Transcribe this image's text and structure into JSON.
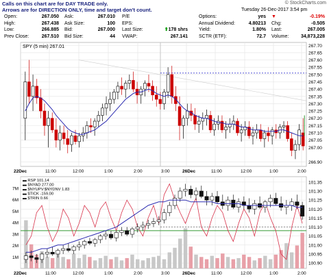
{
  "notice": [
    "Calls on this chart are for DAY TRADE only.",
    "Arrows are for DIRECTION ONLY, time and target don't count."
  ],
  "brand": "© StockCharts.com",
  "datetime": "Tuesday 26-Dec-2017   3:54 pm",
  "quote": {
    "col1": [
      [
        "Open:",
        "267.050"
      ],
      [
        "High:",
        "267.438"
      ],
      [
        "Low:",
        "266.885"
      ],
      [
        "Prev Close:",
        "267.510"
      ]
    ],
    "col2": [
      [
        "Ask:",
        "267.010"
      ],
      [
        "Ask Size:",
        "100"
      ],
      [
        "Bid:",
        "267.000"
      ],
      [
        "Bid Size:",
        "44"
      ]
    ],
    "col3": [
      [
        "P/E",
        ""
      ],
      [
        "EPS:",
        ""
      ],
      [
        "Last Size:",
        "178 shrs"
      ],
      [
        "VWAP:",
        "267.141"
      ]
    ],
    "col4": [
      [
        "Options:",
        "yes"
      ],
      [
        "Annual Dividend:",
        "4.80213"
      ],
      [
        "Yield:",
        "1.80%"
      ],
      [
        "SCTR (ETF):",
        "72.7"
      ]
    ],
    "col5": [
      [
        "",
        "-0.19%"
      ],
      [
        "Chg:",
        "-0.505"
      ],
      [
        "Last:",
        "267.005"
      ],
      [
        "Volume:",
        "34,873,228"
      ]
    ]
  },
  "colors": {
    "up": "#000000",
    "down": "#cc0000",
    "ma": "#2b2bb0",
    "upper_line": "#1d1dcc",
    "rsp": "#111111",
    "nyad": "#d8324a",
    "vol": "#c8c8c8",
    "vol_red": "#e8a0a8",
    "green": "#339933"
  },
  "chart_data": [
    {
      "type": "candlestick",
      "title": "SPY (5 min) 267.01",
      "x_labels": [
        "22Dec",
        "11:00",
        "12:00",
        "1:00",
        "2:00",
        "3:00",
        "26Dec",
        "11:00",
        "12:00",
        "1:00",
        "2:00",
        "3:00"
      ],
      "y_ticks": [
        266.9,
        267.0,
        267.05,
        267.1,
        267.15,
        267.2,
        267.25,
        267.3,
        267.35,
        267.4,
        267.45,
        267.5,
        267.55,
        267.6,
        267.65,
        267.7
      ],
      "ylim": [
        266.87,
        267.72
      ],
      "dashed_level": 267.51,
      "candles_ohlc": [
        [
          267.2,
          267.52,
          267.05,
          267.45
        ],
        [
          267.45,
          267.6,
          267.3,
          267.35
        ],
        [
          267.35,
          267.5,
          267.25,
          267.42
        ],
        [
          267.42,
          267.47,
          267.3,
          267.34
        ],
        [
          267.34,
          267.4,
          267.2,
          267.25
        ],
        [
          267.25,
          267.3,
          267.08,
          267.15
        ],
        [
          267.15,
          267.25,
          267.0,
          267.2
        ],
        [
          267.2,
          267.24,
          267.1,
          267.12
        ],
        [
          267.12,
          267.2,
          267.0,
          267.05
        ],
        [
          267.05,
          267.15,
          266.98,
          267.1
        ],
        [
          267.1,
          267.15,
          267.02,
          267.06
        ],
        [
          267.06,
          267.12,
          266.96,
          267.02
        ],
        [
          267.02,
          267.1,
          266.97,
          267.08
        ],
        [
          267.08,
          267.12,
          267.02,
          267.04
        ],
        [
          267.04,
          267.1,
          267.0,
          267.08
        ],
        [
          267.08,
          267.14,
          267.04,
          267.1
        ],
        [
          267.1,
          267.18,
          267.06,
          267.15
        ],
        [
          267.15,
          267.2,
          267.1,
          267.14
        ],
        [
          267.14,
          267.2,
          267.08,
          267.18
        ],
        [
          267.18,
          267.25,
          267.14,
          267.22
        ],
        [
          267.22,
          267.3,
          267.18,
          267.27
        ],
        [
          267.27,
          267.35,
          267.22,
          267.3
        ],
        [
          267.3,
          267.38,
          267.25,
          267.33
        ],
        [
          267.33,
          267.4,
          267.3,
          267.38
        ],
        [
          267.38,
          267.45,
          267.33,
          267.42
        ],
        [
          267.42,
          267.48,
          267.36,
          267.4
        ],
        [
          267.4,
          267.46,
          267.34,
          267.44
        ],
        [
          267.44,
          267.5,
          267.4,
          267.46
        ],
        [
          267.46,
          267.52,
          267.38,
          267.4
        ],
        [
          267.4,
          267.45,
          267.3,
          267.36
        ],
        [
          267.36,
          267.42,
          267.3,
          267.4
        ],
        [
          267.4,
          267.46,
          267.35,
          267.44
        ],
        [
          267.44,
          267.5,
          267.38,
          267.42
        ],
        [
          267.42,
          267.46,
          267.32,
          267.36
        ],
        [
          267.36,
          267.42,
          267.28,
          267.33
        ],
        [
          267.33,
          267.38,
          267.26,
          267.3
        ],
        [
          267.3,
          267.4,
          267.26,
          267.38
        ],
        [
          267.38,
          267.55,
          267.34,
          267.5
        ],
        [
          267.5,
          267.56,
          267.3,
          267.35
        ],
        [
          267.35,
          267.42,
          267.25,
          267.3
        ],
        [
          267.28,
          267.35,
          267.05,
          267.15
        ],
        [
          267.15,
          267.22,
          267.06,
          267.2
        ],
        [
          267.2,
          267.3,
          267.15,
          267.25
        ],
        [
          267.25,
          267.3,
          267.18,
          267.22
        ],
        [
          267.22,
          267.27,
          267.12,
          267.16
        ],
        [
          267.16,
          267.22,
          267.1,
          267.18
        ],
        [
          267.18,
          267.24,
          267.12,
          267.2
        ],
        [
          267.2,
          267.26,
          267.15,
          267.22
        ],
        [
          267.22,
          267.25,
          267.1,
          267.12
        ],
        [
          267.12,
          267.2,
          267.08,
          267.16
        ],
        [
          267.16,
          267.22,
          267.12,
          267.18
        ],
        [
          267.18,
          267.22,
          267.1,
          267.12
        ],
        [
          267.12,
          267.18,
          267.06,
          267.14
        ],
        [
          267.14,
          267.2,
          267.1,
          267.16
        ],
        [
          267.16,
          267.22,
          267.12,
          267.18
        ],
        [
          267.18,
          267.2,
          267.08,
          267.1
        ],
        [
          267.1,
          267.16,
          267.04,
          267.12
        ],
        [
          267.12,
          267.18,
          267.08,
          267.14
        ],
        [
          267.14,
          267.18,
          267.06,
          267.08
        ],
        [
          267.08,
          267.14,
          267.02,
          267.1
        ],
        [
          267.1,
          267.16,
          267.06,
          267.12
        ],
        [
          267.12,
          267.16,
          267.04,
          267.06
        ],
        [
          267.06,
          267.12,
          267.0,
          267.1
        ],
        [
          267.1,
          267.14,
          267.04,
          267.08
        ],
        [
          267.08,
          267.14,
          267.02,
          267.12
        ],
        [
          267.12,
          267.16,
          267.06,
          267.1
        ],
        [
          267.1,
          267.16,
          267.06,
          267.14
        ],
        [
          267.14,
          267.18,
          267.1,
          267.15
        ],
        [
          267.15,
          267.18,
          267.04,
          267.06
        ],
        [
          267.06,
          267.1,
          266.94,
          266.98
        ],
        [
          266.98,
          267.05,
          266.92,
          267.02
        ],
        [
          267.02,
          267.16,
          266.98,
          267.12
        ],
        [
          267.1,
          267.2,
          266.98,
          267.01
        ]
      ],
      "ma_values": [
        267.25,
        267.3,
        267.34,
        267.35,
        267.34,
        267.32,
        267.29,
        267.26,
        267.22,
        267.19,
        267.16,
        267.13,
        267.11,
        267.1,
        267.09,
        267.09,
        267.1,
        267.11,
        267.12,
        267.14,
        267.16,
        267.18,
        267.21,
        267.24,
        267.27,
        267.3,
        267.33,
        267.35,
        267.37,
        267.38,
        267.38,
        267.39,
        267.4,
        267.39,
        267.37,
        267.36,
        267.35,
        267.36,
        267.35,
        267.33,
        267.3,
        267.27,
        267.25,
        267.24,
        267.22,
        267.21,
        267.2,
        267.2,
        267.19,
        267.18,
        267.17,
        267.17,
        267.16,
        267.16,
        267.16,
        267.15,
        267.14,
        267.14,
        267.13,
        267.12,
        267.12,
        267.12,
        267.11,
        267.11,
        267.11,
        267.11,
        267.12,
        267.12,
        267.11,
        267.1,
        267.09,
        267.08,
        267.08
      ]
    },
    {
      "type": "line",
      "series_labels": [
        "RSP 101.14",
        "$NYAD 277.00",
        "$NYUPV:$NYDNV 1.83",
        "$TICK -159.00",
        "$TRIN 0.66"
      ],
      "x_labels": [
        "22Dec",
        "11:00",
        "12:00",
        "1:00",
        "2:00",
        "3:00",
        "26Dec",
        "11:00",
        "12:00",
        "1:00",
        "2:00",
        "3:00"
      ],
      "y_right_ticks": [
        "101.35",
        "101.30",
        "101.25",
        "101.20",
        "101.15",
        "101.10",
        "101.05",
        "101.00",
        "100.95",
        "100.90"
      ],
      "ylim_right": [
        100.87,
        101.38
      ],
      "y_left_ticks": [
        "7M",
        "6M",
        "5M",
        "4M",
        "3M",
        "2M",
        "1M"
      ],
      "rsp_ohlc": [
        [
          100.92,
          100.96,
          100.9,
          100.94
        ],
        [
          100.94,
          100.97,
          100.91,
          100.93
        ],
        [
          100.93,
          100.95,
          100.9,
          100.92
        ],
        [
          100.92,
          100.96,
          100.9,
          100.95
        ],
        [
          100.95,
          100.98,
          100.93,
          100.96
        ],
        [
          100.96,
          100.99,
          100.94,
          100.95
        ],
        [
          100.95,
          100.98,
          100.93,
          100.97
        ],
        [
          100.97,
          101.0,
          100.95,
          100.98
        ],
        [
          100.98,
          101.01,
          100.96,
          100.97
        ],
        [
          100.97,
          101.0,
          100.95,
          100.99
        ],
        [
          100.99,
          101.02,
          100.97,
          101.0
        ],
        [
          101.0,
          101.03,
          100.98,
          101.02
        ],
        [
          101.02,
          101.04,
          101.0,
          101.01
        ],
        [
          101.01,
          101.04,
          100.99,
          101.03
        ],
        [
          101.03,
          101.06,
          101.01,
          101.05
        ],
        [
          101.05,
          101.08,
          101.03,
          101.06
        ],
        [
          101.06,
          101.08,
          101.03,
          101.04
        ],
        [
          101.04,
          101.08,
          101.02,
          101.07
        ],
        [
          101.07,
          101.1,
          101.05,
          101.08
        ],
        [
          101.08,
          101.1,
          101.05,
          101.06
        ],
        [
          101.06,
          101.1,
          101.04,
          101.09
        ],
        [
          101.09,
          101.12,
          101.07,
          101.1
        ],
        [
          101.1,
          101.13,
          101.08,
          101.11
        ],
        [
          101.11,
          101.14,
          101.09,
          101.12
        ],
        [
          101.12,
          101.15,
          101.1,
          101.13
        ],
        [
          101.13,
          101.16,
          101.11,
          101.14
        ],
        [
          101.14,
          101.2,
          101.12,
          101.18
        ],
        [
          101.18,
          101.24,
          101.16,
          101.22
        ],
        [
          101.22,
          101.28,
          101.2,
          101.26
        ],
        [
          101.26,
          101.32,
          101.24,
          101.3
        ],
        [
          101.3,
          101.34,
          101.27,
          101.31
        ],
        [
          101.31,
          101.33,
          101.26,
          101.28
        ],
        [
          101.28,
          101.32,
          101.25,
          101.3
        ],
        [
          101.3,
          101.33,
          101.26,
          101.27
        ],
        [
          101.27,
          101.3,
          101.22,
          101.25
        ],
        [
          101.25,
          101.29,
          101.22,
          101.27
        ],
        [
          101.27,
          101.3,
          101.23,
          101.24
        ],
        [
          101.24,
          101.28,
          101.2,
          101.22
        ],
        [
          101.22,
          101.27,
          101.19,
          101.25
        ],
        [
          101.25,
          101.28,
          101.2,
          101.21
        ],
        [
          101.21,
          101.26,
          101.18,
          101.24
        ],
        [
          101.24,
          101.27,
          101.2,
          101.22
        ],
        [
          101.22,
          101.26,
          101.18,
          101.2
        ],
        [
          101.2,
          101.25,
          101.17,
          101.23
        ],
        [
          101.23,
          101.27,
          101.2,
          101.21
        ],
        [
          101.21,
          101.25,
          101.18,
          101.24
        ],
        [
          101.24,
          101.28,
          101.21,
          101.26
        ],
        [
          101.26,
          101.29,
          101.22,
          101.23
        ],
        [
          101.23,
          101.27,
          101.19,
          101.21
        ],
        [
          101.21,
          101.25,
          101.17,
          101.22
        ],
        [
          101.22,
          101.26,
          101.19,
          101.24
        ],
        [
          101.24,
          101.28,
          101.2,
          101.22
        ],
        [
          101.22,
          101.24,
          101.14,
          101.16
        ]
      ],
      "nyad_values": [
        101.0,
        101.05,
        101.18,
        101.22,
        101.1,
        101.02,
        101.08,
        101.2,
        101.15,
        101.05,
        101.12,
        101.22,
        101.18,
        101.1,
        101.2,
        101.24,
        101.15,
        101.08,
        101.18,
        101.25,
        101.2,
        101.1,
        101.05,
        101.15,
        101.22,
        101.12,
        101.28,
        101.34,
        101.25,
        101.18,
        101.12,
        101.2,
        101.26,
        101.1,
        101.05,
        101.15,
        101.22,
        101.18,
        101.08,
        101.02,
        101.12,
        101.2,
        101.15,
        101.05,
        101.18,
        101.24,
        101.15,
        101.08,
        100.95,
        100.92,
        101.1,
        101.22,
        101.12
      ],
      "ma_values": [
        100.96,
        100.96,
        100.97,
        100.98,
        100.98,
        100.99,
        101.0,
        101.0,
        101.01,
        101.02,
        101.03,
        101.04,
        101.05,
        101.06,
        101.07,
        101.08,
        101.09,
        101.1,
        101.12,
        101.14,
        101.16,
        101.18,
        101.2,
        101.22,
        101.23,
        101.24,
        101.24,
        101.25,
        101.25,
        101.25,
        101.25,
        101.24,
        101.24,
        101.24,
        101.24,
        101.24,
        101.23,
        101.23,
        101.23,
        101.23,
        101.23,
        101.22,
        101.22,
        101.22,
        101.22,
        101.22,
        101.22,
        101.22,
        101.22,
        101.22,
        101.22,
        101.21,
        101.21
      ],
      "green_level": 101.08,
      "dashed_level": 101.1,
      "volume_m": [
        4.2,
        2.1,
        1.2,
        1.5,
        1.0,
        0.9,
        1.4,
        1.0,
        0.8,
        1.3,
        0.9,
        1.2,
        1.0,
        0.7,
        0.9,
        1.1,
        0.8,
        1.0,
        0.7,
        0.9,
        1.2,
        0.8,
        0.7,
        0.9,
        1.0,
        1.1,
        0.8,
        1.4,
        1.8,
        2.6,
        3.5,
        1.9,
        1.2,
        1.0,
        0.8,
        1.1,
        0.9,
        1.3,
        1.0,
        0.8,
        0.9,
        1.2,
        1.0,
        0.7,
        0.9,
        1.1,
        0.8,
        1.2,
        1.6,
        2.2,
        1.4,
        2.0,
        3.1
      ]
    }
  ]
}
